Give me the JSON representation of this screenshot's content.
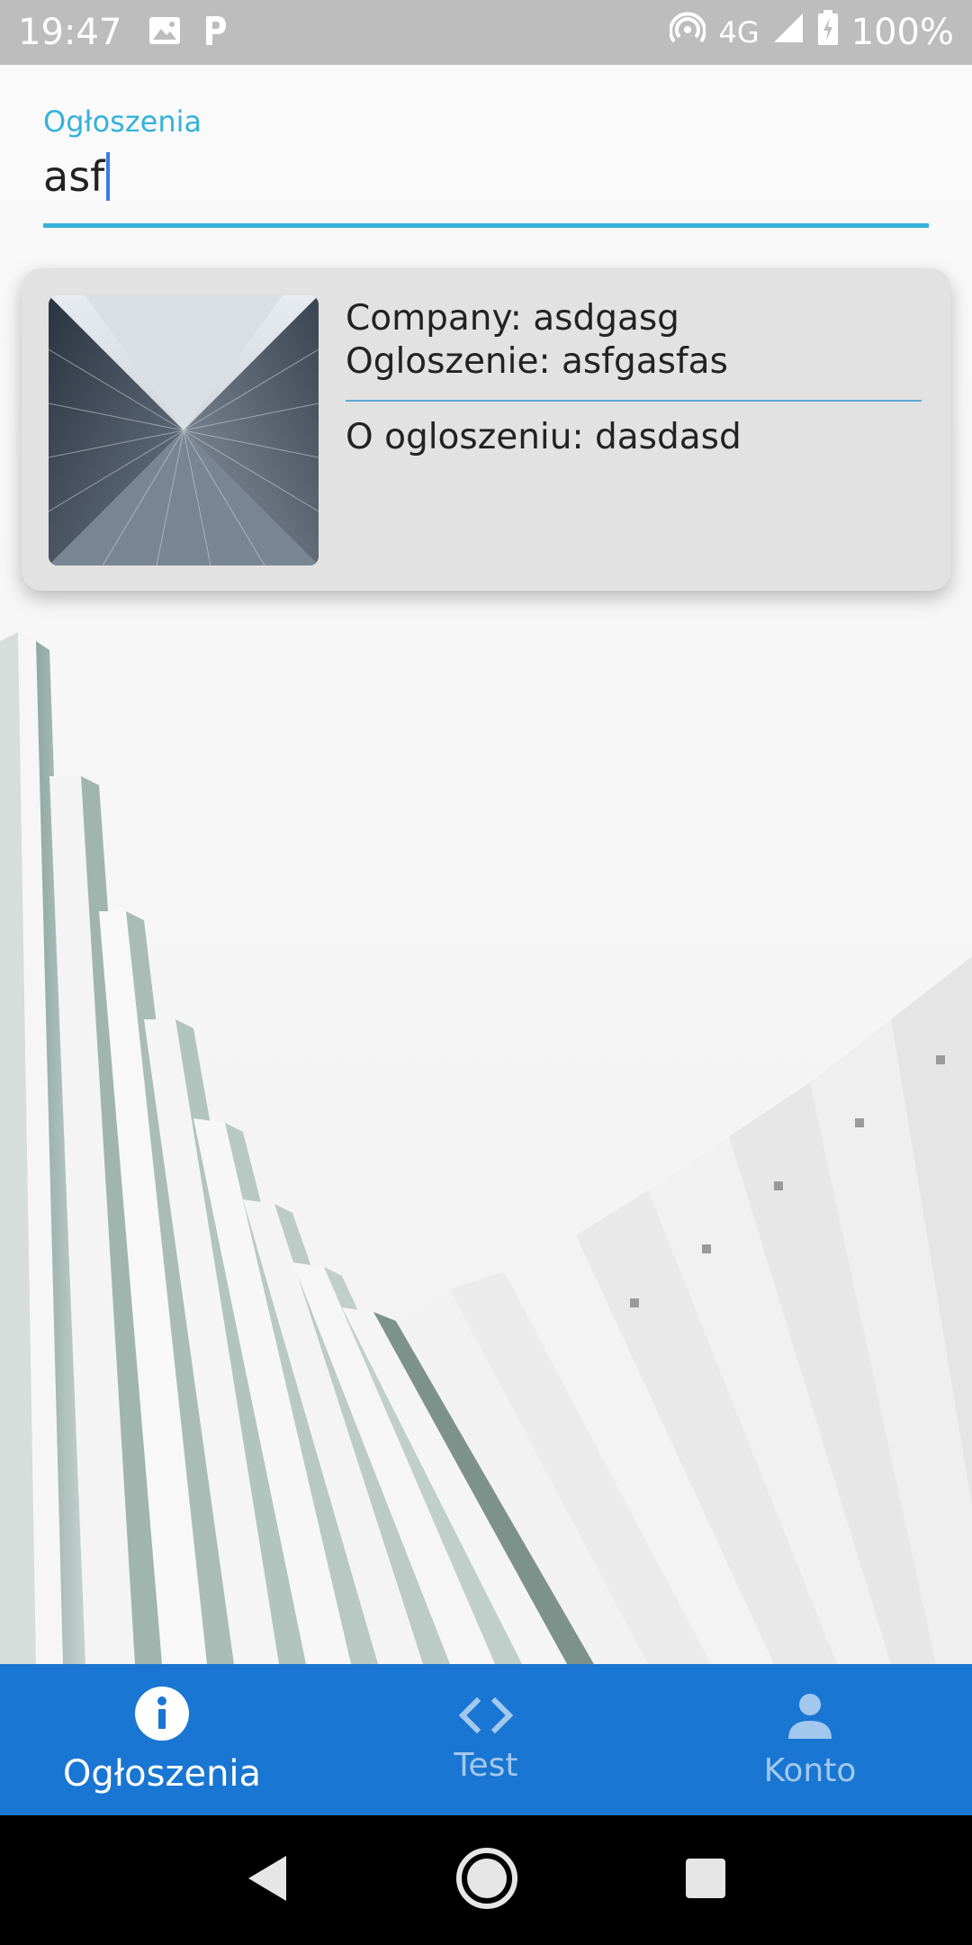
{
  "status_bar": {
    "time": "19:47",
    "network": "4G",
    "battery": "100%"
  },
  "search": {
    "label": "Ogłoszenia",
    "value": "asf"
  },
  "results": [
    {
      "company": "Company: asdgasg",
      "title": "Ogloszenie: asfgasfas",
      "about": "O ogloszeniu: dasdasd"
    }
  ],
  "bottom_nav": {
    "items": [
      {
        "label": "Ogłoszenia",
        "icon": "info-icon",
        "active": true
      },
      {
        "label": "Test",
        "icon": "code-icon",
        "active": false
      },
      {
        "label": "Konto",
        "icon": "person-icon",
        "active": false
      }
    ]
  },
  "colors": {
    "accent": "#35b2dc",
    "nav_bar": "#1976d2",
    "card_bg": "#e2e2e2"
  }
}
